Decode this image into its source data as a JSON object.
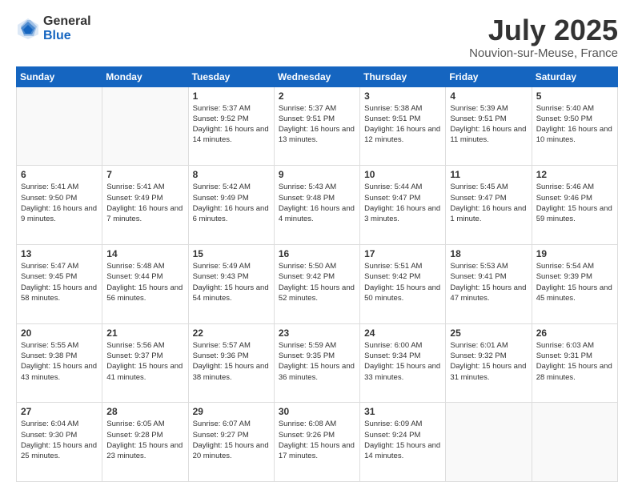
{
  "logo": {
    "general": "General",
    "blue": "Blue"
  },
  "header": {
    "title": "July 2025",
    "subtitle": "Nouvion-sur-Meuse, France"
  },
  "weekdays": [
    "Sunday",
    "Monday",
    "Tuesday",
    "Wednesday",
    "Thursday",
    "Friday",
    "Saturday"
  ],
  "weeks": [
    [
      {
        "day": "",
        "info": ""
      },
      {
        "day": "",
        "info": ""
      },
      {
        "day": "1",
        "info": "Sunrise: 5:37 AM\nSunset: 9:52 PM\nDaylight: 16 hours and 14 minutes."
      },
      {
        "day": "2",
        "info": "Sunrise: 5:37 AM\nSunset: 9:51 PM\nDaylight: 16 hours and 13 minutes."
      },
      {
        "day": "3",
        "info": "Sunrise: 5:38 AM\nSunset: 9:51 PM\nDaylight: 16 hours and 12 minutes."
      },
      {
        "day": "4",
        "info": "Sunrise: 5:39 AM\nSunset: 9:51 PM\nDaylight: 16 hours and 11 minutes."
      },
      {
        "day": "5",
        "info": "Sunrise: 5:40 AM\nSunset: 9:50 PM\nDaylight: 16 hours and 10 minutes."
      }
    ],
    [
      {
        "day": "6",
        "info": "Sunrise: 5:41 AM\nSunset: 9:50 PM\nDaylight: 16 hours and 9 minutes."
      },
      {
        "day": "7",
        "info": "Sunrise: 5:41 AM\nSunset: 9:49 PM\nDaylight: 16 hours and 7 minutes."
      },
      {
        "day": "8",
        "info": "Sunrise: 5:42 AM\nSunset: 9:49 PM\nDaylight: 16 hours and 6 minutes."
      },
      {
        "day": "9",
        "info": "Sunrise: 5:43 AM\nSunset: 9:48 PM\nDaylight: 16 hours and 4 minutes."
      },
      {
        "day": "10",
        "info": "Sunrise: 5:44 AM\nSunset: 9:47 PM\nDaylight: 16 hours and 3 minutes."
      },
      {
        "day": "11",
        "info": "Sunrise: 5:45 AM\nSunset: 9:47 PM\nDaylight: 16 hours and 1 minute."
      },
      {
        "day": "12",
        "info": "Sunrise: 5:46 AM\nSunset: 9:46 PM\nDaylight: 15 hours and 59 minutes."
      }
    ],
    [
      {
        "day": "13",
        "info": "Sunrise: 5:47 AM\nSunset: 9:45 PM\nDaylight: 15 hours and 58 minutes."
      },
      {
        "day": "14",
        "info": "Sunrise: 5:48 AM\nSunset: 9:44 PM\nDaylight: 15 hours and 56 minutes."
      },
      {
        "day": "15",
        "info": "Sunrise: 5:49 AM\nSunset: 9:43 PM\nDaylight: 15 hours and 54 minutes."
      },
      {
        "day": "16",
        "info": "Sunrise: 5:50 AM\nSunset: 9:42 PM\nDaylight: 15 hours and 52 minutes."
      },
      {
        "day": "17",
        "info": "Sunrise: 5:51 AM\nSunset: 9:42 PM\nDaylight: 15 hours and 50 minutes."
      },
      {
        "day": "18",
        "info": "Sunrise: 5:53 AM\nSunset: 9:41 PM\nDaylight: 15 hours and 47 minutes."
      },
      {
        "day": "19",
        "info": "Sunrise: 5:54 AM\nSunset: 9:39 PM\nDaylight: 15 hours and 45 minutes."
      }
    ],
    [
      {
        "day": "20",
        "info": "Sunrise: 5:55 AM\nSunset: 9:38 PM\nDaylight: 15 hours and 43 minutes."
      },
      {
        "day": "21",
        "info": "Sunrise: 5:56 AM\nSunset: 9:37 PM\nDaylight: 15 hours and 41 minutes."
      },
      {
        "day": "22",
        "info": "Sunrise: 5:57 AM\nSunset: 9:36 PM\nDaylight: 15 hours and 38 minutes."
      },
      {
        "day": "23",
        "info": "Sunrise: 5:59 AM\nSunset: 9:35 PM\nDaylight: 15 hours and 36 minutes."
      },
      {
        "day": "24",
        "info": "Sunrise: 6:00 AM\nSunset: 9:34 PM\nDaylight: 15 hours and 33 minutes."
      },
      {
        "day": "25",
        "info": "Sunrise: 6:01 AM\nSunset: 9:32 PM\nDaylight: 15 hours and 31 minutes."
      },
      {
        "day": "26",
        "info": "Sunrise: 6:03 AM\nSunset: 9:31 PM\nDaylight: 15 hours and 28 minutes."
      }
    ],
    [
      {
        "day": "27",
        "info": "Sunrise: 6:04 AM\nSunset: 9:30 PM\nDaylight: 15 hours and 25 minutes."
      },
      {
        "day": "28",
        "info": "Sunrise: 6:05 AM\nSunset: 9:28 PM\nDaylight: 15 hours and 23 minutes."
      },
      {
        "day": "29",
        "info": "Sunrise: 6:07 AM\nSunset: 9:27 PM\nDaylight: 15 hours and 20 minutes."
      },
      {
        "day": "30",
        "info": "Sunrise: 6:08 AM\nSunset: 9:26 PM\nDaylight: 15 hours and 17 minutes."
      },
      {
        "day": "31",
        "info": "Sunrise: 6:09 AM\nSunset: 9:24 PM\nDaylight: 15 hours and 14 minutes."
      },
      {
        "day": "",
        "info": ""
      },
      {
        "day": "",
        "info": ""
      }
    ]
  ]
}
